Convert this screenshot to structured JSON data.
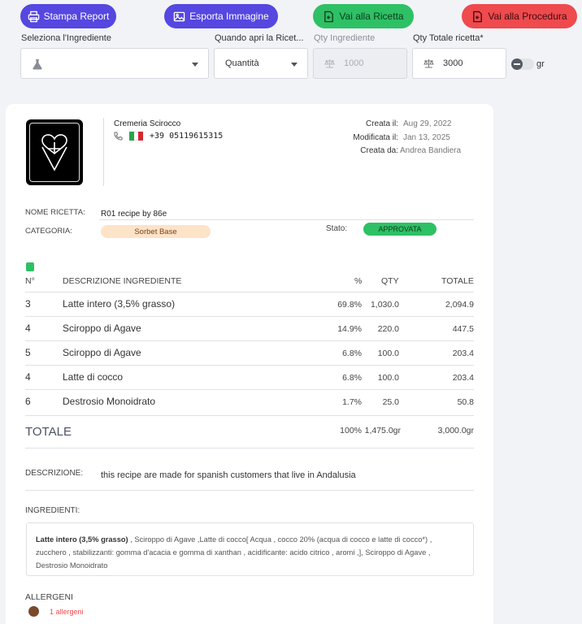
{
  "toolbar": {
    "print_label": "Stampa Report",
    "export_label": "Esporta Immagine",
    "recipe_label": "Vai alla Ricetta",
    "procedure_label": "Vai alla Procedura"
  },
  "filters": {
    "ingredient_label": "Seleziona l'Ingrediente",
    "when_label": "Quando apri la Ricet...",
    "when_value": "Quantità",
    "qty_ingredient_label": "Qty Ingrediente",
    "qty_ingredient_value": "1000",
    "qty_total_label": "Qty Totale ricetta*",
    "qty_total_value": "3000",
    "unit_label": "gr"
  },
  "company": {
    "name": "Cremeria Scirocco",
    "phone": "+39  05119615315"
  },
  "meta": {
    "created_label": "Creata il:",
    "created_value": "Aug 29, 2022",
    "modified_label": "Modificata il:",
    "modified_value": "Jan 13, 2025",
    "created_by_label": "Creata da:",
    "created_by_value": "Andrea Bandiera"
  },
  "recipe": {
    "name_label": "NOME RICETTA:",
    "name_value": "R01 recipe by 86e",
    "category_label": "CATEGORIA:",
    "category_value": "Sorbet Base",
    "status_label": "Stato:",
    "status_value": "APPROVATA"
  },
  "table": {
    "headers": {
      "num": "N°",
      "desc": "DESCRIZIONE INGREDIENTE",
      "pct": "%",
      "qty": "QTY",
      "total": "TOTALE"
    },
    "rows": [
      {
        "n": "3",
        "desc": "Latte intero (3,5% grasso)",
        "pct": "69.8%",
        "qty": "1,030.0",
        "total": "2,094.9"
      },
      {
        "n": "4",
        "desc": "Sciroppo di Agave",
        "pct": "14.9%",
        "qty": "220.0",
        "total": "447.5"
      },
      {
        "n": "5",
        "desc": "Sciroppo di Agave",
        "pct": "6.8%",
        "qty": "100.0",
        "total": "203.4"
      },
      {
        "n": "4",
        "desc": "Latte di cocco",
        "pct": "6.8%",
        "qty": "100.0",
        "total": "203.4"
      },
      {
        "n": "6",
        "desc": "Destrosio Monoidrato",
        "pct": "1.7%",
        "qty": "25.0",
        "total": "50.8"
      }
    ],
    "total_label": "TOTALE",
    "total_pct": "100%",
    "total_qty": "1,475.0gr",
    "total_total": "3,000.0gr"
  },
  "description": {
    "label": "DESCRIZIONE:",
    "text": "this recipe are made for spanish customers that live in Andalusia"
  },
  "ingredients": {
    "label": "INGREDIENTI:",
    "bold_part": "Latte intero (3,5% grasso)",
    "rest": " , Sciroppo di Agave ,Latte di cocco[ Acqua , cocco 20% (acqua di cocco e latte di cocco*) , zucchero , stabilizzanti: gomma d'acacia e gomma di xanthan , acidificante: acido citrico , aromi ,], Sciroppo di Agave , Destrosio Monoidrato"
  },
  "allergens": {
    "label": "ALLERGENI",
    "count_text": "1 allergeni"
  },
  "colors": {
    "primary": "#5547e0",
    "success": "#2ec065",
    "danger": "#ef4a4e",
    "category_badge": "#fde3c8"
  }
}
